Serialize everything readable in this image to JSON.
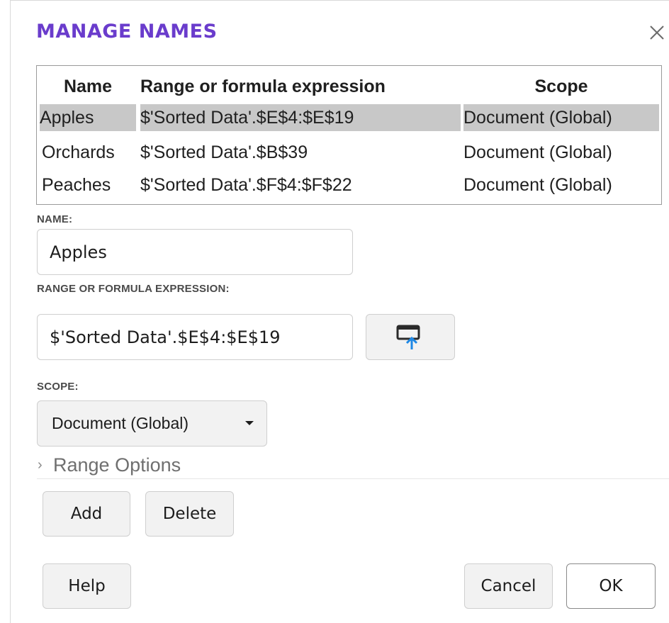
{
  "dialog": {
    "title": "MANAGE NAMES"
  },
  "table": {
    "headers": {
      "name": "Name",
      "range": "Range or formula expression",
      "scope": "Scope"
    },
    "rows": [
      {
        "name": "Apples",
        "range": "$'Sorted Data'.$E$4:$E$19",
        "scope": "Document (Global)",
        "selected": true
      },
      {
        "name": "Orchards",
        "range": "$'Sorted Data'.$B$39",
        "scope": "Document (Global)",
        "selected": false
      },
      {
        "name": "Peaches",
        "range": "$'Sorted Data'.$F$4:$F$22",
        "scope": "Document (Global)",
        "selected": false
      }
    ]
  },
  "form": {
    "name_label": "NAME:",
    "name_value": "Apples",
    "range_label": "RANGE OR FORMULA EXPRESSION:",
    "range_value": "$'Sorted Data'.$E$4:$E$19",
    "scope_label": "SCOPE:",
    "scope_value": "Document (Global)",
    "range_options_label": "Range Options"
  },
  "buttons": {
    "add": "Add",
    "delete": "Delete",
    "help": "Help",
    "cancel": "Cancel",
    "ok": "OK"
  },
  "icons": {
    "close": "close-icon",
    "shrink": "shrink-icon",
    "expand": "chevron-right-icon",
    "dropdown": "caret-down-icon"
  },
  "colors": {
    "title": "#6a3ccc",
    "selection": "#c8c8c8",
    "shrink_arrow": "#1e88e5"
  }
}
